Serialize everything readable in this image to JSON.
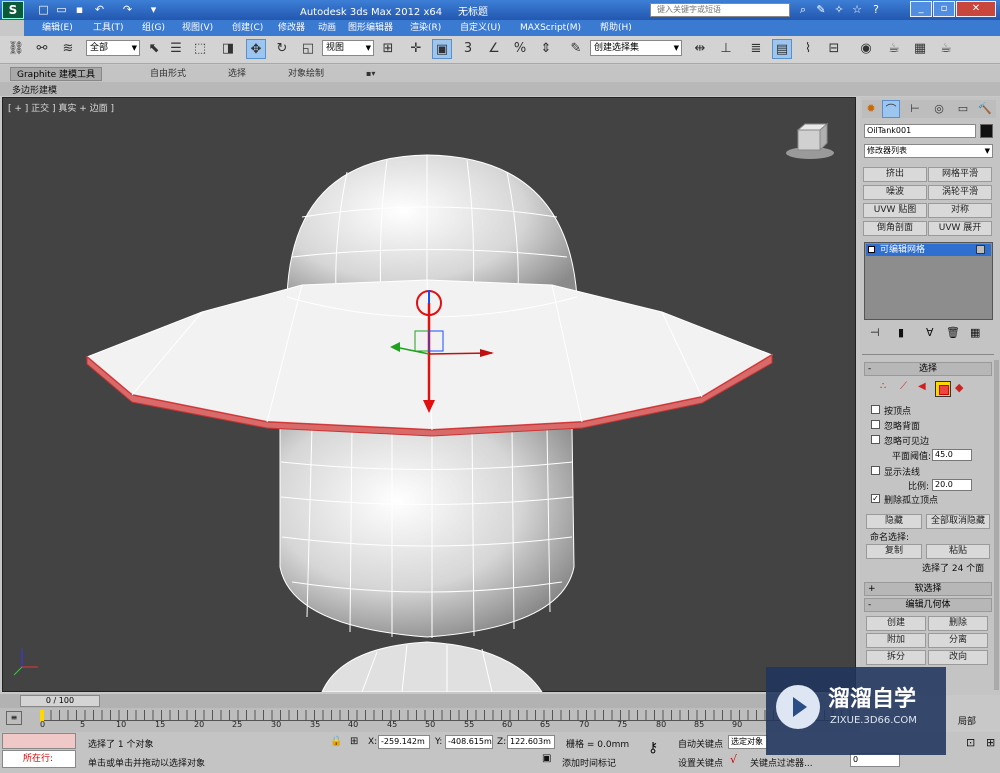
{
  "title": {
    "app": "Autodesk 3ds Max  2012 x64",
    "doc": "无标题",
    "search_placeholder": "键入关键字或短语"
  },
  "menu": [
    "编辑(E)",
    "工具(T)",
    "组(G)",
    "视图(V)",
    "创建(C)",
    "修改器",
    "动画",
    "图形编辑器",
    "渲染(R)",
    "自定义(U)",
    "MAXScript(M)",
    "帮助(H)"
  ],
  "toolbar": {
    "filter": "全部",
    "refcoord": "视图",
    "selset": "创建选择集"
  },
  "ribbon": {
    "tabs": [
      "Graphite 建模工具",
      "自由形式",
      "选择",
      "对象绘制"
    ],
    "sub": "多边形建模"
  },
  "viewport": {
    "label": "[ + ] 正交 ] 真实 + 边面 ]"
  },
  "panel": {
    "object_name": "OilTank001",
    "modifier_list": "修改器列表",
    "mod_buttons": [
      "挤出",
      "网格平滑",
      "噪波",
      "涡轮平滑",
      "UVW 贴图",
      "对称",
      "倒角剖面",
      "UVW 展开"
    ],
    "stack_item": "可编辑网格",
    "selection": {
      "title": "选择",
      "by_vertex": "按顶点",
      "ignore_backface": "忽略背面",
      "ignore_visible": "忽略可见边",
      "planar_thresh_label": "平面阈值:",
      "planar_thresh": "45.0",
      "show_normals": "显示法线",
      "scale_label": "比例:",
      "scale": "20.0",
      "delete_isolated": "删除孤立顶点",
      "hide": "隐藏",
      "unhide_all": "全部取消隐藏",
      "named_sel": "命名选择:",
      "copy": "复制",
      "paste": "粘贴",
      "sel_count": "选择了 24 个面"
    },
    "soft_sel": "软选择",
    "edit_geo": "编辑几何体",
    "geo_buttons": [
      "创建",
      "删除",
      "附加",
      "分离",
      "拆分",
      "改向"
    ],
    "local": "局部"
  },
  "timeline": {
    "frame": "0 / 100",
    "ticks": [
      "0",
      "5",
      "10",
      "15",
      "20",
      "25",
      "30",
      "35",
      "40",
      "45",
      "50",
      "55",
      "60",
      "65",
      "70",
      "75",
      "80",
      "85",
      "90"
    ]
  },
  "status": {
    "running": "所在行:",
    "msg1": "选择了 1 个对象",
    "msg2": "单击或单击并拖动以选择对象",
    "x_label": "X:",
    "x": "-259.142m",
    "y_label": "Y:",
    "y": "-408.615m",
    "z_label": "Z:",
    "z": "122.603m",
    "grid": "栅格 = 0.0mm",
    "autokey": "自动关键点",
    "selected": "选定对象",
    "setkey": "设置关键点",
    "keyfilter": "关键点过滤器...",
    "add_time_tag": "添加时间标记",
    "frame_field": "0"
  },
  "watermark": {
    "brand": "溜溜自学",
    "url": "ZIXUE.3D66.COM"
  }
}
